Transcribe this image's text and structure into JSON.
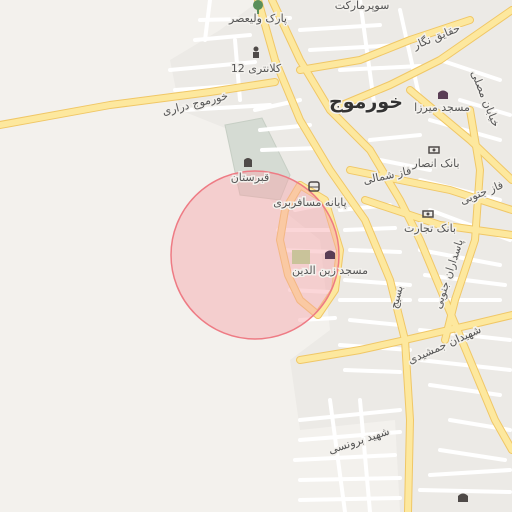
{
  "map": {
    "city_label": "خورموج",
    "places": {
      "supermarket": "سوپرمارکت",
      "park": "پارک ولیعصر",
      "hedayat_street": "حقایق نگار",
      "police_station": "کلانتری 12",
      "mirza_mosque": "مسجد میرزا",
      "mosalla_street": "خیابان مصلی",
      "dorahi_road": "خورموج دراری",
      "cemetery": "قبرستان",
      "ansar_bank": "بانک انصار",
      "north_phase": "فاز شمالی",
      "south_phase": "فاز جنوبی",
      "bus_terminal": "پایانه مسافربری",
      "tejarat_bank": "بانک تجارت",
      "zeinoddin_mosque": "مسجد زین الدین",
      "pasdaran_south": "پاسداران جنوبی",
      "basij": "بسیج",
      "jamshidi_martyrs": "شهیدان جمشیدی",
      "martyr_boroonsi": "شهید برونسی"
    },
    "colors": {
      "background": "#f3f1ed",
      "main_road": "#fde89e",
      "main_road_edge": "#f0c766",
      "minor_road": "#ffffff",
      "minor_road_edge": "#d9d4cc",
      "radius_fill": "#f6a3a8",
      "radius_stroke": "#ee7b84",
      "cemetery_fill": "#d5dbd3",
      "label_text": "#555555",
      "icon_color": "#5a3e55",
      "bank_icon": "#4f4a48"
    },
    "icons": {
      "park": "tree-icon",
      "police": "police-icon",
      "mosque": "mosque-icon",
      "bank": "bank-icon",
      "bus": "bus-icon",
      "cemetery": "cemetery-icon"
    }
  }
}
